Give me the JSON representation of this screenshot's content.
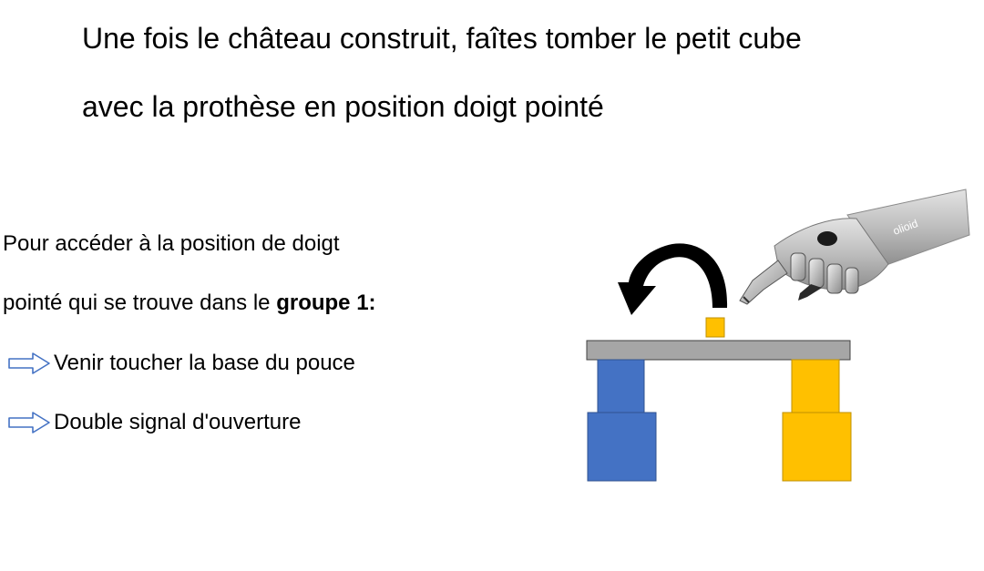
{
  "title": {
    "line1": "Une fois le château construit, faîtes tomber le petit cube",
    "line2": "avec la prothèse en position doigt pointé"
  },
  "instructions": {
    "line1": "Pour accéder à la position de doigt",
    "line2_prefix": "pointé qui se trouve dans le ",
    "line2_bold": "groupe 1:",
    "steps": [
      "Venir toucher la base du pouce",
      "Double signal d'ouverture"
    ]
  },
  "illustration": {
    "prosthesis_label": "olioid",
    "colors": {
      "blue_block": "#4472C4",
      "yellow_block": "#FFC000",
      "plank": "#A6A6A6",
      "arrow": "#000000"
    }
  }
}
